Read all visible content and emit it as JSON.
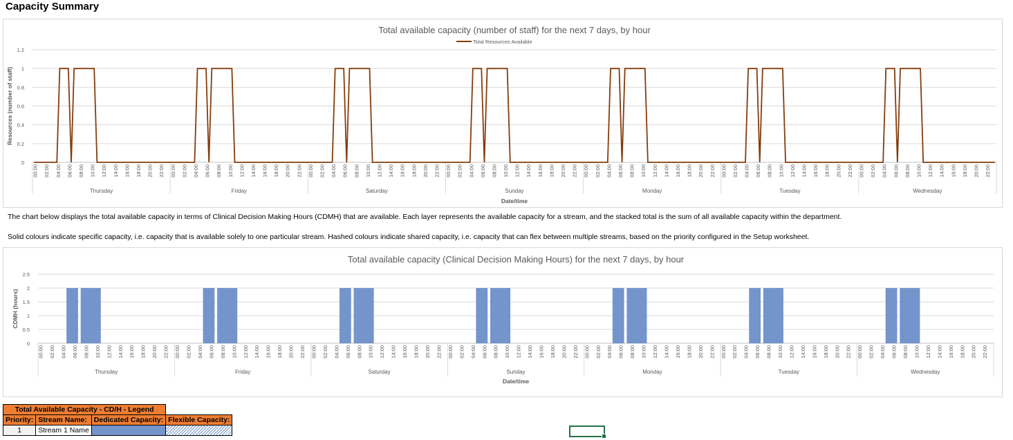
{
  "page_title": "Capacity Summary",
  "notes": [
    "The chart below displays the total available capacity in terms of Clinical Decision Making Hours (CDMH) that are available. Each layer represents the available capacity for a stream, and the stacked total is the sum of all available capacity within the department.",
    "Solid colours indicate specific capacity, i.e. capacity that is available solely to one particular stream. Hashed colours indicate shared capacity, i.e. capacity that can flex between multiple streams, based on the priority configured in the Setup worksheet."
  ],
  "legend_table": {
    "title": "Total Available Capacity - CD/H - Legend",
    "headers": [
      "Priority:",
      "Stream Name:",
      "Dedicated Capacity:",
      "Flexible Capacity:"
    ],
    "rows": [
      {
        "priority": "1",
        "stream_name": "Stream 1 Name"
      }
    ],
    "dedicated_color": "#7494cc"
  },
  "chart_data": [
    {
      "type": "line",
      "title": "Total available capacity (number of staff) for the next 7 days, by hour",
      "xlabel": "Date/time",
      "ylabel": "Resources (number of staff)",
      "ylim": [
        0,
        1.2
      ],
      "yticks": [
        "0",
        "0.2",
        "0.4",
        "0.6",
        "0.8",
        "1",
        "1.2"
      ],
      "days": [
        "Thursday",
        "Friday",
        "Saturday",
        "Sunday",
        "Monday",
        "Tuesday",
        "Wednesday"
      ],
      "hour_ticks": [
        "00:00",
        "02:00",
        "04:00",
        "06:00",
        "08:00",
        "10:00",
        "12:00",
        "14:00",
        "16:00",
        "18:00",
        "20:00",
        "22:00"
      ],
      "legend_position": "top-center",
      "grid": true,
      "color": "#843c0c",
      "series": [
        {
          "name": "Total Resources Available",
          "daily_values": [
            0,
            0,
            0,
            0,
            0,
            0,
            0,
            0,
            0,
            1,
            1,
            1,
            1,
            0,
            1,
            1,
            1,
            1,
            1,
            1,
            1,
            1,
            0,
            0,
            0,
            0,
            0,
            0,
            0,
            0,
            0,
            0,
            0,
            0,
            0,
            0,
            0,
            0,
            0,
            0,
            0,
            0,
            0,
            0,
            0,
            0,
            0,
            0
          ]
        }
      ]
    },
    {
      "type": "bar",
      "stacked": true,
      "title": "Total available capacity (Clinical Decision Making Hours) for the next 7 days, by hour",
      "xlabel": "Date/time",
      "ylabel": "CDMH (hours)",
      "ylim": [
        0,
        2.5
      ],
      "yticks": [
        "0",
        "0.5",
        "1",
        "1.5",
        "2",
        "2.5"
      ],
      "days": [
        "Thursday",
        "Friday",
        "Saturday",
        "Sunday",
        "Monday",
        "Tuesday",
        "Wednesday"
      ],
      "hour_ticks": [
        "00:00",
        "02:00",
        "04:00",
        "06:00",
        "08:00",
        "10:00",
        "12:00",
        "14:00",
        "16:00",
        "18:00",
        "20:00",
        "22:00"
      ],
      "grid": true,
      "color": "#7494cc",
      "series": [
        {
          "daily_values": [
            0,
            0,
            0,
            0,
            0,
            0,
            0,
            0,
            0,
            0,
            2,
            2,
            2,
            2,
            0,
            2,
            2,
            2,
            2,
            2,
            2,
            2,
            0,
            0,
            0,
            0,
            0,
            0,
            0,
            0,
            0,
            0,
            0,
            0,
            0,
            0,
            0,
            0,
            0,
            0,
            0,
            0,
            0,
            0,
            0,
            0,
            0,
            0
          ]
        }
      ]
    }
  ]
}
